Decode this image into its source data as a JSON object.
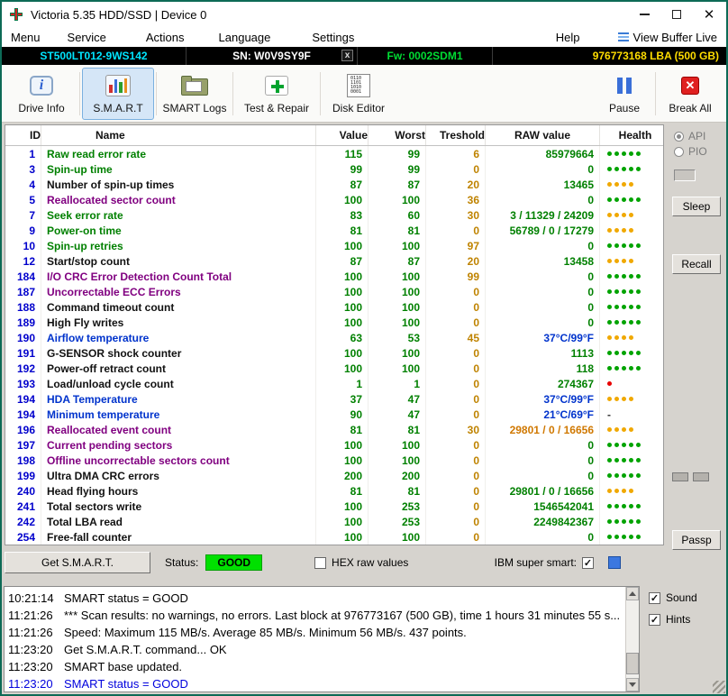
{
  "window": {
    "title": "Victoria 5.35 HDD/SSD | Device 0"
  },
  "menu": {
    "left_items": [
      "Menu",
      "Service",
      "Actions",
      "Language",
      "Settings"
    ],
    "help": "Help",
    "view_buffer": "View Buffer Live"
  },
  "device_bar": {
    "model": "ST500LT012-9WS142",
    "serial": "SN: W0V9SY9F",
    "close": "x",
    "firmware": "Fw: 0002SDM1",
    "capacity": "976773168 LBA (500 GB)"
  },
  "toolbar": {
    "buttons": [
      {
        "label": "Drive Info",
        "icon": "drive-info-icon"
      },
      {
        "label": "S.M.A.R.T",
        "icon": "smart-chart-icon",
        "selected": true
      },
      {
        "label": "SMART Logs",
        "icon": "folder-icon"
      },
      {
        "label": "Test & Repair",
        "icon": "repair-cross-icon"
      },
      {
        "label": "Disk Editor",
        "icon": "binary-page-icon"
      },
      {
        "label": "Pause",
        "icon": "pause-icon"
      },
      {
        "label": "Break All",
        "icon": "break-x-icon"
      }
    ]
  },
  "side_panel": {
    "api": "API",
    "pio": "PIO",
    "sleep": "Sleep",
    "recall": "Recall",
    "passp": "Passp"
  },
  "status_bar": {
    "get_smart": "Get S.M.A.R.T.",
    "status_label": "Status:",
    "status_value": "GOOD",
    "hex_label": "HEX raw values",
    "hex_checked": false,
    "ibm_label": "IBM super smart:",
    "ibm_checked": true,
    "good_bg_color": "#00e000"
  },
  "smart_table": {
    "headers": [
      "ID",
      "Name",
      "Value",
      "Worst",
      "Treshold",
      "RAW value",
      "Health"
    ],
    "rows": [
      {
        "id": "1",
        "name": "Raw read error rate",
        "name_color": "green",
        "value": "115",
        "worst": "99",
        "treshold": "6",
        "raw": "85979664",
        "raw_color": "green",
        "health": {
          "dots": 5,
          "color": "green"
        }
      },
      {
        "id": "3",
        "name": "Spin-up time",
        "name_color": "green",
        "value": "99",
        "worst": "99",
        "treshold": "0",
        "raw": "0",
        "raw_color": "green",
        "health": {
          "dots": 5,
          "color": "green"
        }
      },
      {
        "id": "4",
        "name": "Number of spin-up times",
        "name_color": "black",
        "value": "87",
        "worst": "87",
        "treshold": "20",
        "raw": "13465",
        "raw_color": "green",
        "health": {
          "dots": 4,
          "color": "orange"
        }
      },
      {
        "id": "5",
        "name": "Reallocated sector count",
        "name_color": "purple",
        "value": "100",
        "worst": "100",
        "treshold": "36",
        "raw": "0",
        "raw_color": "green",
        "health": {
          "dots": 5,
          "color": "green"
        }
      },
      {
        "id": "7",
        "name": "Seek error rate",
        "name_color": "green",
        "value": "83",
        "worst": "60",
        "treshold": "30",
        "raw": "3 / 11329 / 24209",
        "raw_color": "green",
        "health": {
          "dots": 4,
          "color": "orange"
        }
      },
      {
        "id": "9",
        "name": "Power-on time",
        "name_color": "green",
        "value": "81",
        "worst": "81",
        "treshold": "0",
        "raw": "56789 / 0 / 17279",
        "raw_color": "green",
        "health": {
          "dots": 4,
          "color": "orange"
        }
      },
      {
        "id": "10",
        "name": "Spin-up retries",
        "name_color": "green",
        "value": "100",
        "worst": "100",
        "treshold": "97",
        "raw": "0",
        "raw_color": "green",
        "health": {
          "dots": 5,
          "color": "green"
        }
      },
      {
        "id": "12",
        "name": "Start/stop count",
        "name_color": "black",
        "value": "87",
        "worst": "87",
        "treshold": "20",
        "raw": "13458",
        "raw_color": "green",
        "health": {
          "dots": 4,
          "color": "orange"
        }
      },
      {
        "id": "184",
        "name": "I/O CRC Error Detection Count Total",
        "name_color": "purple",
        "value": "100",
        "worst": "100",
        "treshold": "99",
        "raw": "0",
        "raw_color": "green",
        "health": {
          "dots": 5,
          "color": "green"
        }
      },
      {
        "id": "187",
        "name": "Uncorrectable ECC Errors",
        "name_color": "purple",
        "value": "100",
        "worst": "100",
        "treshold": "0",
        "raw": "0",
        "raw_color": "green",
        "health": {
          "dots": 5,
          "color": "green"
        }
      },
      {
        "id": "188",
        "name": "Command timeout count",
        "name_color": "black",
        "value": "100",
        "worst": "100",
        "treshold": "0",
        "raw": "0",
        "raw_color": "green",
        "health": {
          "dots": 5,
          "color": "green"
        }
      },
      {
        "id": "189",
        "name": "High Fly writes",
        "name_color": "black",
        "value": "100",
        "worst": "100",
        "treshold": "0",
        "raw": "0",
        "raw_color": "green",
        "health": {
          "dots": 5,
          "color": "green"
        }
      },
      {
        "id": "190",
        "name": "Airflow temperature",
        "name_color": "blue",
        "value": "63",
        "worst": "53",
        "treshold": "45",
        "raw": "37°C/99°F",
        "raw_color": "blue",
        "health": {
          "dots": 4,
          "color": "orange"
        }
      },
      {
        "id": "191",
        "name": "G-SENSOR shock counter",
        "name_color": "black",
        "value": "100",
        "worst": "100",
        "treshold": "0",
        "raw": "1113",
        "raw_color": "green",
        "health": {
          "dots": 5,
          "color": "green"
        }
      },
      {
        "id": "192",
        "name": "Power-off retract count",
        "name_color": "black",
        "value": "100",
        "worst": "100",
        "treshold": "0",
        "raw": "118",
        "raw_color": "green",
        "health": {
          "dots": 5,
          "color": "green"
        }
      },
      {
        "id": "193",
        "name": "Load/unload cycle count",
        "name_color": "black",
        "value": "1",
        "worst": "1",
        "treshold": "0",
        "raw": "274367",
        "raw_color": "green",
        "health": {
          "dots": 1,
          "color": "red"
        }
      },
      {
        "id": "194",
        "name": "HDA Temperature",
        "name_color": "blue",
        "value": "37",
        "worst": "47",
        "treshold": "0",
        "raw": "37°C/99°F",
        "raw_color": "blue",
        "health": {
          "dots": 4,
          "color": "orange"
        }
      },
      {
        "id": "194",
        "name": "Minimum temperature",
        "name_color": "blue",
        "value": "90",
        "worst": "47",
        "treshold": "0",
        "raw": "21°C/69°F",
        "raw_color": "blue",
        "health": {
          "dash": true
        }
      },
      {
        "id": "196",
        "name": "Reallocated event count",
        "name_color": "purple",
        "value": "81",
        "worst": "81",
        "treshold": "30",
        "raw": "29801 / 0 / 16656",
        "raw_color": "orange",
        "health": {
          "dots": 4,
          "color": "orange"
        }
      },
      {
        "id": "197",
        "name": "Current pending sectors",
        "name_color": "purple",
        "value": "100",
        "worst": "100",
        "treshold": "0",
        "raw": "0",
        "raw_color": "green",
        "health": {
          "dots": 5,
          "color": "green"
        }
      },
      {
        "id": "198",
        "name": "Offline uncorrectable sectors count",
        "name_color": "purple",
        "value": "100",
        "worst": "100",
        "treshold": "0",
        "raw": "0",
        "raw_color": "green",
        "health": {
          "dots": 5,
          "color": "green"
        }
      },
      {
        "id": "199",
        "name": "Ultra DMA CRC errors",
        "name_color": "black",
        "value": "200",
        "worst": "200",
        "treshold": "0",
        "raw": "0",
        "raw_color": "green",
        "health": {
          "dots": 5,
          "color": "green"
        }
      },
      {
        "id": "240",
        "name": "Head flying hours",
        "name_color": "black",
        "value": "81",
        "worst": "81",
        "treshold": "0",
        "raw": "29801 / 0 / 16656",
        "raw_color": "green",
        "health": {
          "dots": 4,
          "color": "orange"
        }
      },
      {
        "id": "241",
        "name": "Total sectors write",
        "name_color": "black",
        "value": "100",
        "worst": "253",
        "treshold": "0",
        "raw": "1546542041",
        "raw_color": "green",
        "health": {
          "dots": 5,
          "color": "green"
        }
      },
      {
        "id": "242",
        "name": "Total LBA read",
        "name_color": "black",
        "value": "100",
        "worst": "253",
        "treshold": "0",
        "raw": "2249842367",
        "raw_color": "green",
        "health": {
          "dots": 5,
          "color": "green"
        }
      },
      {
        "id": "254",
        "name": "Free-fall counter",
        "name_color": "black",
        "value": "100",
        "worst": "100",
        "treshold": "0",
        "raw": "0",
        "raw_color": "green",
        "health": {
          "dots": 5,
          "color": "green"
        }
      }
    ]
  },
  "log": {
    "lines": [
      {
        "time": "10:21:14",
        "text": "SMART status = GOOD",
        "color": "black"
      },
      {
        "time": "11:21:26",
        "text": "*** Scan results: no warnings, no errors. Last block at 976773167 (500 GB), time 1 hours 31 minutes 55 s...",
        "color": "black"
      },
      {
        "time": "11:21:26",
        "text": "Speed: Maximum 115 MB/s. Average 85 MB/s. Minimum 56 MB/s. 437 points.",
        "color": "black"
      },
      {
        "time": "11:23:20",
        "text": "Get S.M.A.R.T. command... OK",
        "color": "black"
      },
      {
        "time": "11:23:20",
        "text": "SMART base updated.",
        "color": "black"
      },
      {
        "time": "11:23:20",
        "text": "SMART status = GOOD",
        "color": "blue"
      }
    ],
    "sound_label": "Sound",
    "sound_checked": true,
    "hints_label": "Hints",
    "hints_checked": true
  }
}
